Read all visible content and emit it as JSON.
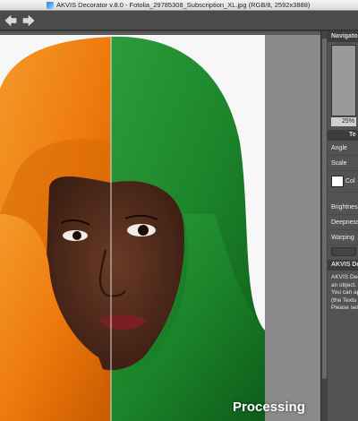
{
  "window": {
    "title": "AKVIS Decorator v.8.0 - Fotolia_29785308_Subscription_XL.jpg (RGB/8, 2592x3888)"
  },
  "toolbar": {
    "buttons": [
      {
        "name": "undo",
        "icon": "arrow-left-icon"
      },
      {
        "name": "redo",
        "icon": "arrow-right-icon"
      }
    ]
  },
  "canvas": {
    "overlay_text": "Processing",
    "colors": {
      "left_scarf": "#f07a10",
      "right_scarf": "#1f8a2e",
      "background": "#f7f7f7"
    }
  },
  "panel": {
    "navigator_title": "Navigator",
    "zoom": "25%",
    "section_title": "Te",
    "rows": {
      "angle": "Angle",
      "scale": "Scale",
      "color": "Col",
      "brightness": "Brightness",
      "deepness": "Deepness",
      "warping": "Warping"
    },
    "swatch_color": "#ffffff",
    "info": {
      "title": "AKVIS Deco",
      "lines": [
        "AKVIS Dec",
        "an object.",
        "You can ap",
        "(the Textu",
        "Please sele"
      ]
    }
  }
}
